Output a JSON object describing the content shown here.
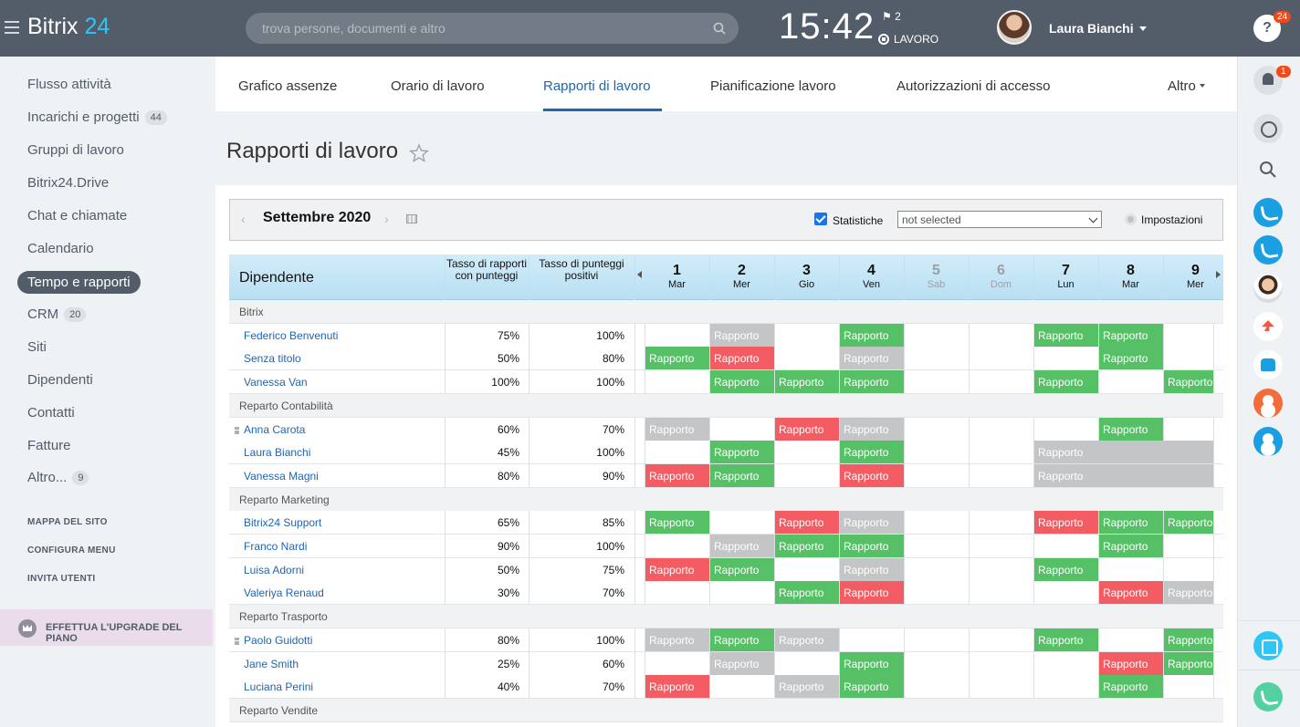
{
  "header": {
    "logo_main": "Bitrix",
    "logo_num": "24",
    "search_placeholder": "trova persone, documenti e altro",
    "clock": "15:42",
    "flag_count": "2",
    "work_status": "LAVORO",
    "user_name": "Laura Bianchi",
    "help_badge": "24"
  },
  "sidebar": {
    "items": [
      {
        "label": "Flusso attività"
      },
      {
        "label": "Incarichi e progetti",
        "count": "44"
      },
      {
        "label": "Gruppi di lavoro"
      },
      {
        "label": "Bitrix24.Drive"
      },
      {
        "label": "Chat e chiamate"
      },
      {
        "label": "Calendario"
      },
      {
        "label": "Tempo e rapporti",
        "active": true
      },
      {
        "label": "CRM",
        "count": "20"
      },
      {
        "label": "Siti"
      },
      {
        "label": "Dipendenti"
      },
      {
        "label": "Contatti"
      },
      {
        "label": "Fatture"
      },
      {
        "label": "Altro...",
        "count": "9"
      }
    ],
    "links": [
      "MAPPA DEL SITO",
      "CONFIGURA MENU",
      "INVITA UTENTI"
    ],
    "upgrade": "EFFETTUA L'UPGRADE DEL PIANO"
  },
  "rightbar": {
    "bell_badge": "1"
  },
  "tabs": [
    {
      "label": "Grafico assenze"
    },
    {
      "label": "Orario di lavoro"
    },
    {
      "label": "Rapporti di lavoro",
      "active": true
    },
    {
      "label": "Pianificazione lavoro"
    },
    {
      "label": "Autorizzazioni di accesso"
    }
  ],
  "tab_more": "Altro",
  "page_title": "Rapporti di lavoro",
  "toolbar": {
    "month": "Settembre 2020",
    "stats_label": "Statistiche",
    "stats_checked": true,
    "select_value": "not selected",
    "settings_label": "Impostazioni"
  },
  "table": {
    "col_employee": "Dipendente",
    "col_rate": "Tasso di rapporti con punteggi",
    "col_positive": "Tasso di punteggi positivi",
    "days": [
      {
        "num": "1",
        "wd": "Mar"
      },
      {
        "num": "2",
        "wd": "Mer"
      },
      {
        "num": "3",
        "wd": "Gio"
      },
      {
        "num": "4",
        "wd": "Ven"
      },
      {
        "num": "5",
        "wd": "Sab",
        "weekend": true
      },
      {
        "num": "6",
        "wd": "Dom",
        "weekend": true
      },
      {
        "num": "7",
        "wd": "Lun"
      },
      {
        "num": "8",
        "wd": "Mar"
      },
      {
        "num": "9",
        "wd": "Mer"
      }
    ],
    "report_label": "Rapporto",
    "groups": [
      {
        "name": "Bitrix",
        "employees": [
          {
            "name": "Federico Benvenuti",
            "rate": "75%",
            "positive": "100%",
            "cells": [
              "",
              "y",
              "",
              "g",
              "",
              "",
              "g",
              "g",
              ""
            ]
          },
          {
            "name": "Senza titolo",
            "rate": "50%",
            "positive": "80%",
            "cells": [
              "g",
              "r",
              "",
              "y",
              "",
              "",
              "",
              "g",
              ""
            ]
          },
          {
            "name": "Vanessa Van",
            "rate": "100%",
            "positive": "100%",
            "cells": [
              "",
              "g",
              "g",
              "g",
              "",
              "",
              "g",
              "",
              "g"
            ]
          }
        ]
      },
      {
        "name": "Reparto Contabilità",
        "employees": [
          {
            "name": "Anna Carota",
            "icon": true,
            "rate": "60%",
            "positive": "70%",
            "cells": [
              "y",
              "",
              "r",
              "y",
              "",
              "",
              "",
              "g",
              ""
            ]
          },
          {
            "name": "Laura Bianchi",
            "rate": "45%",
            "positive": "100%",
            "cells": [
              "",
              "g",
              "",
              "g",
              "",
              "",
              "y3",
              "",
              ""
            ]
          },
          {
            "name": "Vanessa Magni",
            "rate": "80%",
            "positive": "90%",
            "cells": [
              "r",
              "g",
              "",
              "r",
              "",
              "",
              "y3",
              "",
              ""
            ]
          }
        ]
      },
      {
        "name": "Reparto Marketing",
        "employees": [
          {
            "name": "Bitrix24 Support",
            "rate": "65%",
            "positive": "85%",
            "cells": [
              "g",
              "",
              "r",
              "y",
              "",
              "",
              "r",
              "g",
              "g"
            ]
          },
          {
            "name": "Franco Nardi",
            "rate": "90%",
            "positive": "100%",
            "cells": [
              "",
              "y",
              "g",
              "g",
              "",
              "",
              "",
              "g",
              ""
            ]
          },
          {
            "name": "Luisa Adorni",
            "rate": "50%",
            "positive": "75%",
            "cells": [
              "r",
              "g",
              "",
              "y",
              "",
              "",
              "g",
              "",
              ""
            ]
          },
          {
            "name": "Valeriya Renaud",
            "rate": "30%",
            "positive": "70%",
            "cells": [
              "",
              "",
              "g",
              "r",
              "",
              "",
              "",
              "r",
              "y"
            ]
          }
        ]
      },
      {
        "name": "Reparto Trasporto",
        "employees": [
          {
            "name": "Paolo Guidotti",
            "icon": true,
            "rate": "80%",
            "positive": "100%",
            "cells": [
              "y",
              "g",
              "y",
              "",
              "",
              "",
              "g",
              "",
              "g"
            ]
          },
          {
            "name": "Jane Smith",
            "rate": "25%",
            "positive": "60%",
            "cells": [
              "",
              "y",
              "",
              "g",
              "",
              "",
              "",
              "r",
              "g"
            ]
          },
          {
            "name": "Luciana Perini",
            "rate": "40%",
            "positive": "70%",
            "cells": [
              "r",
              "",
              "y",
              "g",
              "",
              "",
              "",
              "g",
              ""
            ]
          }
        ]
      },
      {
        "name": "Reparto Vendite",
        "employees": []
      }
    ]
  },
  "colors": {
    "good": "#55c066",
    "bad": "#f25c62",
    "neutral": "#c3c5c7",
    "accent": "#2066b0"
  }
}
